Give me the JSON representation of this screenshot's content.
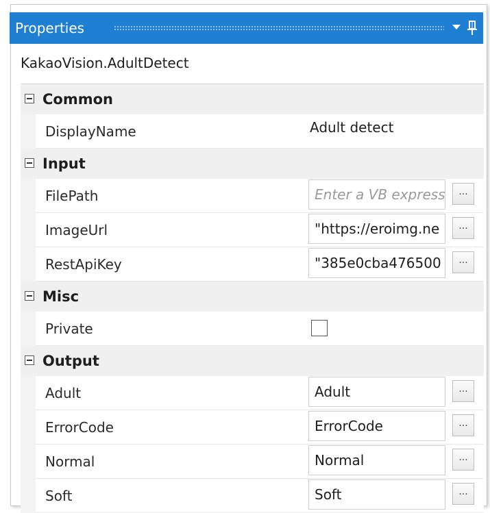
{
  "panel": {
    "title": "Properties",
    "subtitle": "KakaoVision.AdultDetect"
  },
  "icons": {
    "dropdown": "chevron-down-icon",
    "pin": "pin-icon",
    "collapse": "minus-box-icon",
    "browse": "ellipsis-button"
  },
  "colors": {
    "titlebar": "#1f7fd2",
    "category_bg": "#f0f0f0"
  },
  "categories": {
    "common": {
      "label": "Common",
      "displayname": {
        "name": "DisplayName",
        "value": "Adult detect"
      }
    },
    "input": {
      "label": "Input",
      "filepath": {
        "name": "FilePath",
        "placeholder": "Enter a VB expression"
      },
      "imageurl": {
        "name": "ImageUrl",
        "value": "\"https://eroimg.ne"
      },
      "restapikey": {
        "name": "RestApiKey",
        "value": "\"385e0cba476500"
      }
    },
    "misc": {
      "label": "Misc",
      "private": {
        "name": "Private",
        "checked": false
      }
    },
    "output": {
      "label": "Output",
      "adult": {
        "name": "Adult",
        "value": "Adult"
      },
      "errorcode": {
        "name": "ErrorCode",
        "value": "ErrorCode"
      },
      "normal": {
        "name": "Normal",
        "value": "Normal"
      },
      "soft": {
        "name": "Soft",
        "value": "Soft"
      }
    }
  },
  "browse_label": "..."
}
